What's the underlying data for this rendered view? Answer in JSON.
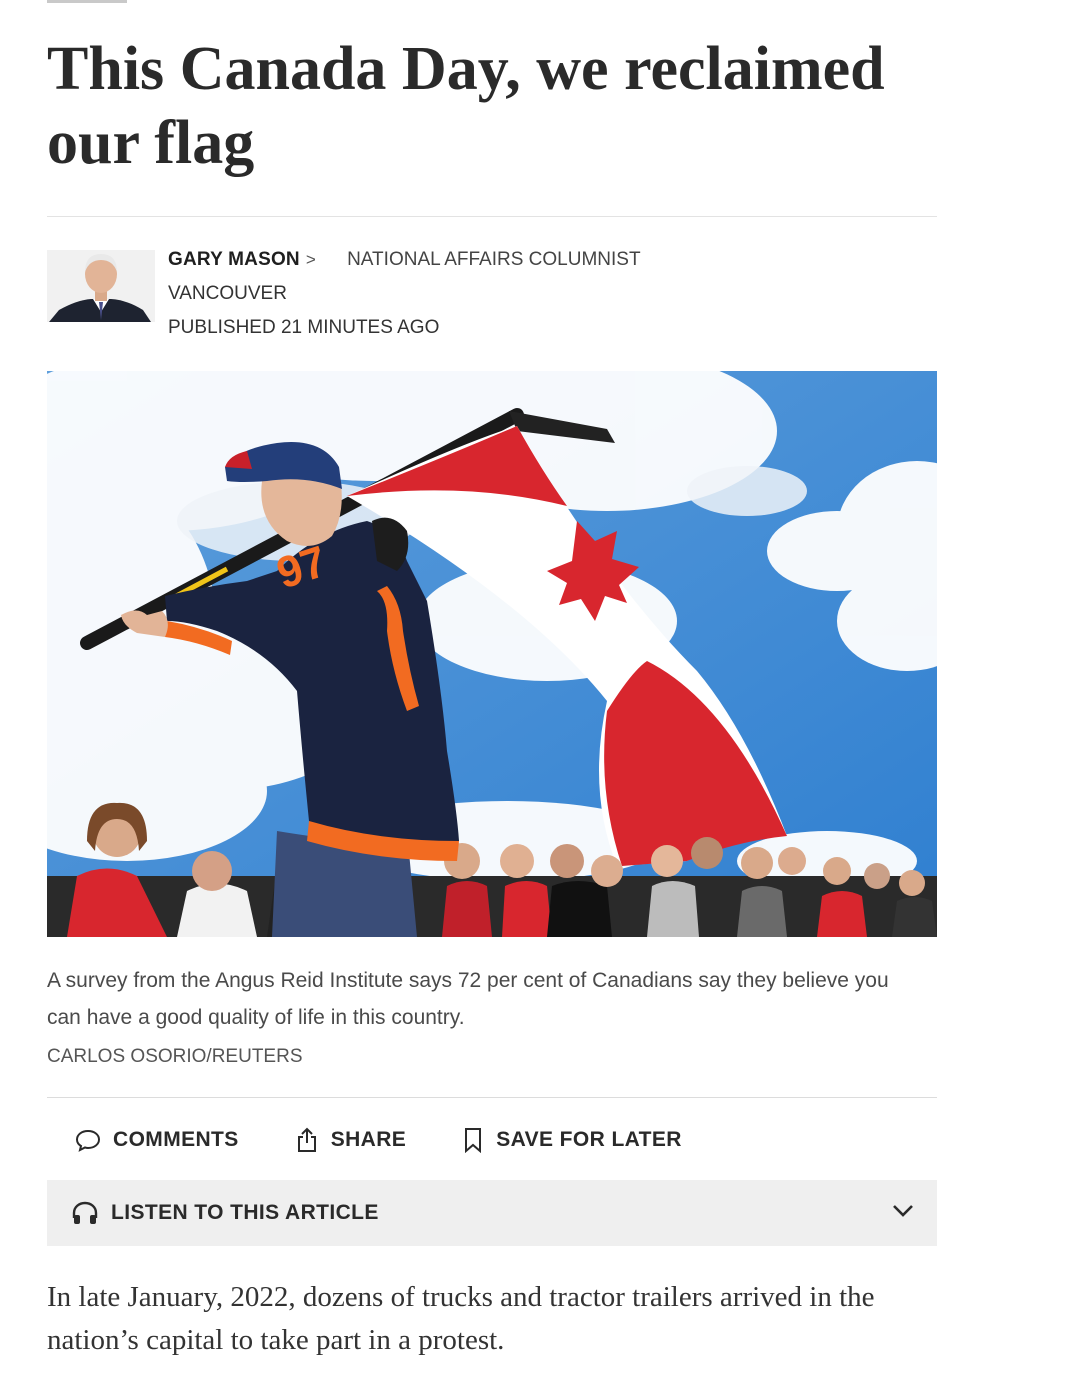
{
  "article": {
    "headline": "This Canada Day, we reclaimed our flag",
    "author": {
      "name": "GARY MASON",
      "chevron": ">",
      "role": "NATIONAL AFFAIRS COLUMNIST",
      "location": "VANCOUVER",
      "published": "PUBLISHED 21 MINUTES AGO"
    },
    "image": {
      "caption": "A survey from the Angus Reid Institute says 72 per cent of Canadians say they believe you can have a good quality of life in this country.",
      "credit": "CARLOS OSORIO/REUTERS",
      "jersey_number": "97"
    },
    "actions": {
      "comments": "COMMENTS",
      "share": "SHARE",
      "save": "SAVE FOR LATER"
    },
    "listen": {
      "label": "LISTEN TO THIS ARTICLE"
    },
    "lead_paragraph": "In late January, 2022, dozens of trucks and tractor trailers arrived in the nation’s capital to take part in a protest."
  },
  "icons": {
    "comments": "speech-bubble-icon",
    "share": "share-icon",
    "save": "bookmark-icon",
    "listen": "headphones-icon",
    "expand": "chevron-down-icon"
  },
  "colors": {
    "flag_red": "#d8262e",
    "jersey_navy": "#1a2340",
    "jersey_orange": "#f26b21",
    "sky": "#3f8ad3"
  }
}
